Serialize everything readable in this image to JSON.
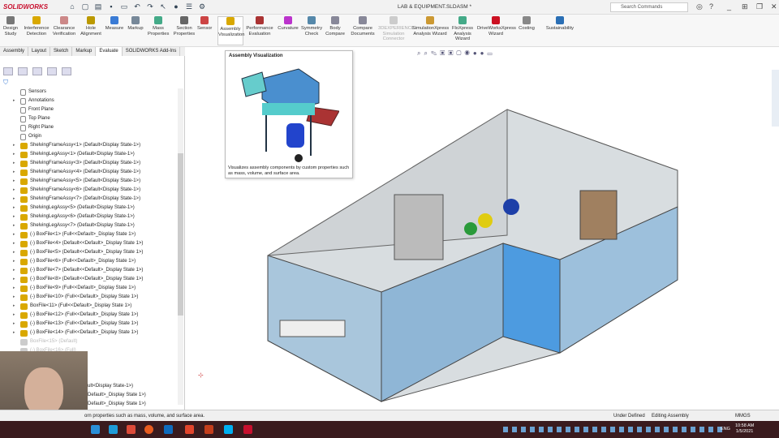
{
  "app": {
    "brand": "SOLIDWORKS",
    "title": "LAB & EQUIPMENT.SLDASM *",
    "search_placeholder": "Search Commands"
  },
  "ribbon": [
    {
      "label": "Design Study",
      "color": "#777"
    },
    {
      "label": "Interference Detection",
      "color": "#d9a800"
    },
    {
      "label": "Clearance Verification",
      "color": "#c88"
    },
    {
      "label": "Hole Alignment",
      "color": "#b90"
    },
    {
      "label": "Measure",
      "color": "#3a7bd5"
    },
    {
      "label": "Markup",
      "color": "#789"
    },
    {
      "label": "Mass Properties",
      "color": "#4a8"
    },
    {
      "label": "Section Properties",
      "color": "#666"
    },
    {
      "label": "Sensor",
      "color": "#c44"
    },
    {
      "label": "Assembly Visualization",
      "color": "#d9a800"
    },
    {
      "label": "Performance Evaluation",
      "color": "#a33"
    },
    {
      "label": "Curvature",
      "color": "#b3c"
    },
    {
      "label": "Symmetry Check",
      "color": "#58a"
    },
    {
      "label": "Body Compare",
      "color": "#889"
    },
    {
      "label": "Compare Documents",
      "color": "#889"
    },
    {
      "label": "3DEXPERIENCE Simulation Connector",
      "color": "#ccc"
    },
    {
      "label": "SimulationXpress Analysis Wizard",
      "color": "#c93"
    },
    {
      "label": "FloXpress Analysis Wizard",
      "color": "#4a8"
    },
    {
      "label": "DriveWorksXpress Wizard",
      "color": "#c12"
    },
    {
      "label": "Costing",
      "color": "#888"
    },
    {
      "label": "Sustainability",
      "color": "#2a6fb5"
    }
  ],
  "tabs": [
    "Assembly",
    "Layout",
    "Sketch",
    "Markup",
    "Evaluate",
    "SOLIDWORKS Add-Ins"
  ],
  "active_tab": "Evaluate",
  "tree": [
    {
      "label": "Sensors",
      "type": "folder"
    },
    {
      "label": "Annotations",
      "type": "folder"
    },
    {
      "label": "Front Plane",
      "type": "plane"
    },
    {
      "label": "Top Plane",
      "type": "plane"
    },
    {
      "label": "Right Plane",
      "type": "plane"
    },
    {
      "label": "Origin",
      "type": "origin"
    },
    {
      "label": "ShelvingFrameAssy<1> (Default<Display State-1>)"
    },
    {
      "label": "ShelvingLegAssy<1> (Default<Display State-1>)"
    },
    {
      "label": "ShelvingFrameAssy<3> (Default<Display State-1>)"
    },
    {
      "label": "ShelvingFrameAssy<4> (Default<Display State-1>)"
    },
    {
      "label": "ShelvingFrameAssy<5> (Default<Display State-1>)"
    },
    {
      "label": "ShelvingFrameAssy<6> (Default<Display State-1>)"
    },
    {
      "label": "ShelvingFrameAssy<7> (Default<Display State-1>)"
    },
    {
      "label": "ShelvingLegAssy<5> (Default<Display State-1>)"
    },
    {
      "label": "ShelvingLegAssy<6> (Default<Display State-1>)"
    },
    {
      "label": "ShelvingLegAssy<7> (Default<Display State-1>)"
    },
    {
      "label": "(-) BoxFile<1> (Full<<Default>_Display State 1>)"
    },
    {
      "label": "(-) BoxFile<4> (Default<<Default>_Display State 1>)"
    },
    {
      "label": "(-) BoxFile<5> (Default<<Default>_Display State 1>)"
    },
    {
      "label": "(-) BoxFile<6> (Full<<Default>_Display State 1>)"
    },
    {
      "label": "(-) BoxFile<7> (Default<<Default>_Display State 1>)"
    },
    {
      "label": "(-) BoxFile<8> (Default<<Default>_Display State 1>)"
    },
    {
      "label": "(-) BoxFile<9> (Full<<Default>_Display State 1>)"
    },
    {
      "label": "(-) BoxFile<10> (Full<<Default>_Display State 1>)"
    },
    {
      "label": "BoxFile<11> (Full<<Default>_Display State 1>)"
    },
    {
      "label": "(-) BoxFile<12> (Full<<Default>_Display State 1>)"
    },
    {
      "label": "(-) BoxFile<13> (Full<<Default>_Display State 1>)"
    },
    {
      "label": "(-) BoxFile<14> (Full<<Default>_Display State 1>)"
    },
    {
      "label": "BoxFile<15> (Default)",
      "dim": true
    },
    {
      "label": "(-) BoxFile<16> (Full)",
      "dim": true
    }
  ],
  "tree_partial": [
    "ult<Display State-1>)",
    "Default>_Display State 1>)",
    "Default>_Display State 1>)"
  ],
  "tooltip": {
    "title": "Assembly Visualization",
    "description": "Visualizes assembly components by custom properties such as mass, volume, and surface area."
  },
  "status": {
    "message": "orn properties such as mass, volume, and surface area.",
    "state": "Under Defined",
    "mode": "Editing Assembly",
    "units": "MMGS"
  },
  "clock": {
    "time": "10:58 AM",
    "date": "1/5/2021",
    "lang": "ENG"
  }
}
